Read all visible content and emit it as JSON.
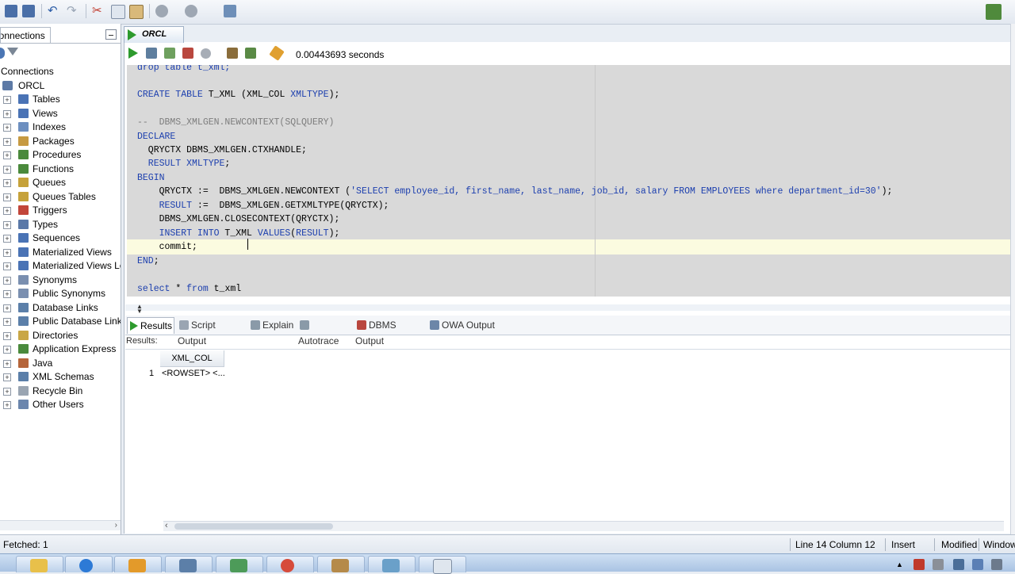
{
  "connections_panel": {
    "tab_label": "Connections",
    "root_label": "Connections",
    "connection_name": "ORCL",
    "tree_items": [
      {
        "label": "Tables",
        "icon": "table-icon"
      },
      {
        "label": "Views",
        "icon": "view-icon"
      },
      {
        "label": "Indexes",
        "icon": "index-icon"
      },
      {
        "label": "Packages",
        "icon": "package-icon"
      },
      {
        "label": "Procedures",
        "icon": "procedure-icon"
      },
      {
        "label": "Functions",
        "icon": "function-icon"
      },
      {
        "label": "Queues",
        "icon": "queue-icon"
      },
      {
        "label": "Queues Tables",
        "icon": "queue-table-icon"
      },
      {
        "label": "Triggers",
        "icon": "trigger-icon"
      },
      {
        "label": "Types",
        "icon": "type-icon"
      },
      {
        "label": "Sequences",
        "icon": "sequence-icon"
      },
      {
        "label": "Materialized Views",
        "icon": "materialized-view-icon"
      },
      {
        "label": "Materialized Views Lo",
        "icon": "materialized-view-log-icon"
      },
      {
        "label": "Synonyms",
        "icon": "synonym-icon"
      },
      {
        "label": "Public Synonyms",
        "icon": "public-synonym-icon"
      },
      {
        "label": "Database Links",
        "icon": "database-link-icon"
      },
      {
        "label": "Public Database Links",
        "icon": "public-database-link-icon"
      },
      {
        "label": "Directories",
        "icon": "directory-icon"
      },
      {
        "label": "Application Express",
        "icon": "application-express-icon"
      },
      {
        "label": "Java",
        "icon": "java-icon"
      },
      {
        "label": "XML Schemas",
        "icon": "xml-schema-icon"
      },
      {
        "label": "Recycle Bin",
        "icon": "recycle-bin-icon"
      },
      {
        "label": "Other Users",
        "icon": "users-icon"
      }
    ]
  },
  "editor": {
    "tab_label": "ORCL",
    "execution_time": "0.00443693 seconds",
    "code_lines": [
      {
        "parts": [
          {
            "t": "drop table t_xml;",
            "c": "kw"
          }
        ]
      },
      {
        "parts": [
          {
            "t": "CREATE TABLE",
            "c": "kw"
          },
          {
            "t": " T_XML (XML_COL ",
            "c": ""
          },
          {
            "t": "XMLTYPE",
            "c": "kw"
          },
          {
            "t": ");",
            "c": ""
          }
        ]
      },
      {
        "parts": []
      },
      {
        "parts": [
          {
            "t": "--  DBMS_XMLGEN.NEWCONTEXT(SQLQUERY)",
            "c": "cmt"
          }
        ]
      },
      {
        "parts": [
          {
            "t": "DECLARE",
            "c": "kw"
          }
        ]
      },
      {
        "parts": [
          {
            "t": "  QRYCTX DBMS_XMLGEN.CTXHANDLE;",
            "c": ""
          }
        ]
      },
      {
        "parts": [
          {
            "t": "  RESULT XMLTYPE",
            "c": "kw"
          },
          {
            "t": ";",
            "c": ""
          }
        ]
      },
      {
        "parts": [
          {
            "t": "BEGIN",
            "c": "kw"
          }
        ]
      },
      {
        "parts": [
          {
            "t": "    QRYCTX :=  DBMS_XMLGEN.NEWCONTEXT (",
            "c": ""
          },
          {
            "t": "'SELECT employee_id, first_name, last_name, job_id, salary FROM EMPLOYEES where department_id=30'",
            "c": "str"
          },
          {
            "t": ");",
            "c": ""
          }
        ]
      },
      {
        "parts": [
          {
            "t": "    RESULT",
            "c": "kw"
          },
          {
            "t": " :=  DBMS_XMLGEN.GETXMLTYPE(QRYCTX);",
            "c": ""
          }
        ]
      },
      {
        "parts": [
          {
            "t": "    DBMS_XMLGEN.CLOSECONTEXT(QRYCTX);",
            "c": ""
          }
        ]
      },
      {
        "parts": [
          {
            "t": "    INSERT INTO",
            "c": "kw"
          },
          {
            "t": " T_XML ",
            "c": ""
          },
          {
            "t": "VALUES",
            "c": "kw"
          },
          {
            "t": "(",
            "c": ""
          },
          {
            "t": "RESULT",
            "c": "kw"
          },
          {
            "t": ");",
            "c": ""
          }
        ]
      },
      {
        "parts": [
          {
            "t": "    commit;",
            "c": ""
          }
        ]
      },
      {
        "parts": [
          {
            "t": "END",
            "c": "kw"
          },
          {
            "t": ";",
            "c": ""
          }
        ]
      },
      {
        "parts": []
      },
      {
        "parts": [
          {
            "t": "select",
            "c": "kw"
          },
          {
            "t": " * ",
            "c": ""
          },
          {
            "t": "from",
            "c": "kw"
          },
          {
            "t": " t_xml",
            "c": ""
          }
        ]
      }
    ]
  },
  "results": {
    "tabs": [
      {
        "label": "Results",
        "icon": "results-icon",
        "active": true
      },
      {
        "label": "Script Output",
        "icon": "script-output-icon",
        "active": false
      },
      {
        "label": "Explain",
        "icon": "explain-icon",
        "active": false
      },
      {
        "label": "Autotrace",
        "icon": "autotrace-icon",
        "active": false
      },
      {
        "label": "DBMS Output",
        "icon": "dbms-output-icon",
        "active": false
      },
      {
        "label": "OWA Output",
        "icon": "owa-output-icon",
        "active": false
      }
    ],
    "label": "Results:",
    "column_header": "XML_COL",
    "rows": [
      {
        "num": "1",
        "value": "<ROWSET> <..."
      }
    ]
  },
  "status_bar": {
    "fetched": "Fetched: 1",
    "position": "Line 14 Column 12",
    "mode": "Insert",
    "modified": "Modified",
    "platform": "Window"
  },
  "colors": {
    "keyword": "#1c3fae",
    "comment": "#7d7d7d",
    "current_line": "#fbfbe0",
    "code_background": "#d9d9d9",
    "run_green": "#2d9a2d"
  }
}
